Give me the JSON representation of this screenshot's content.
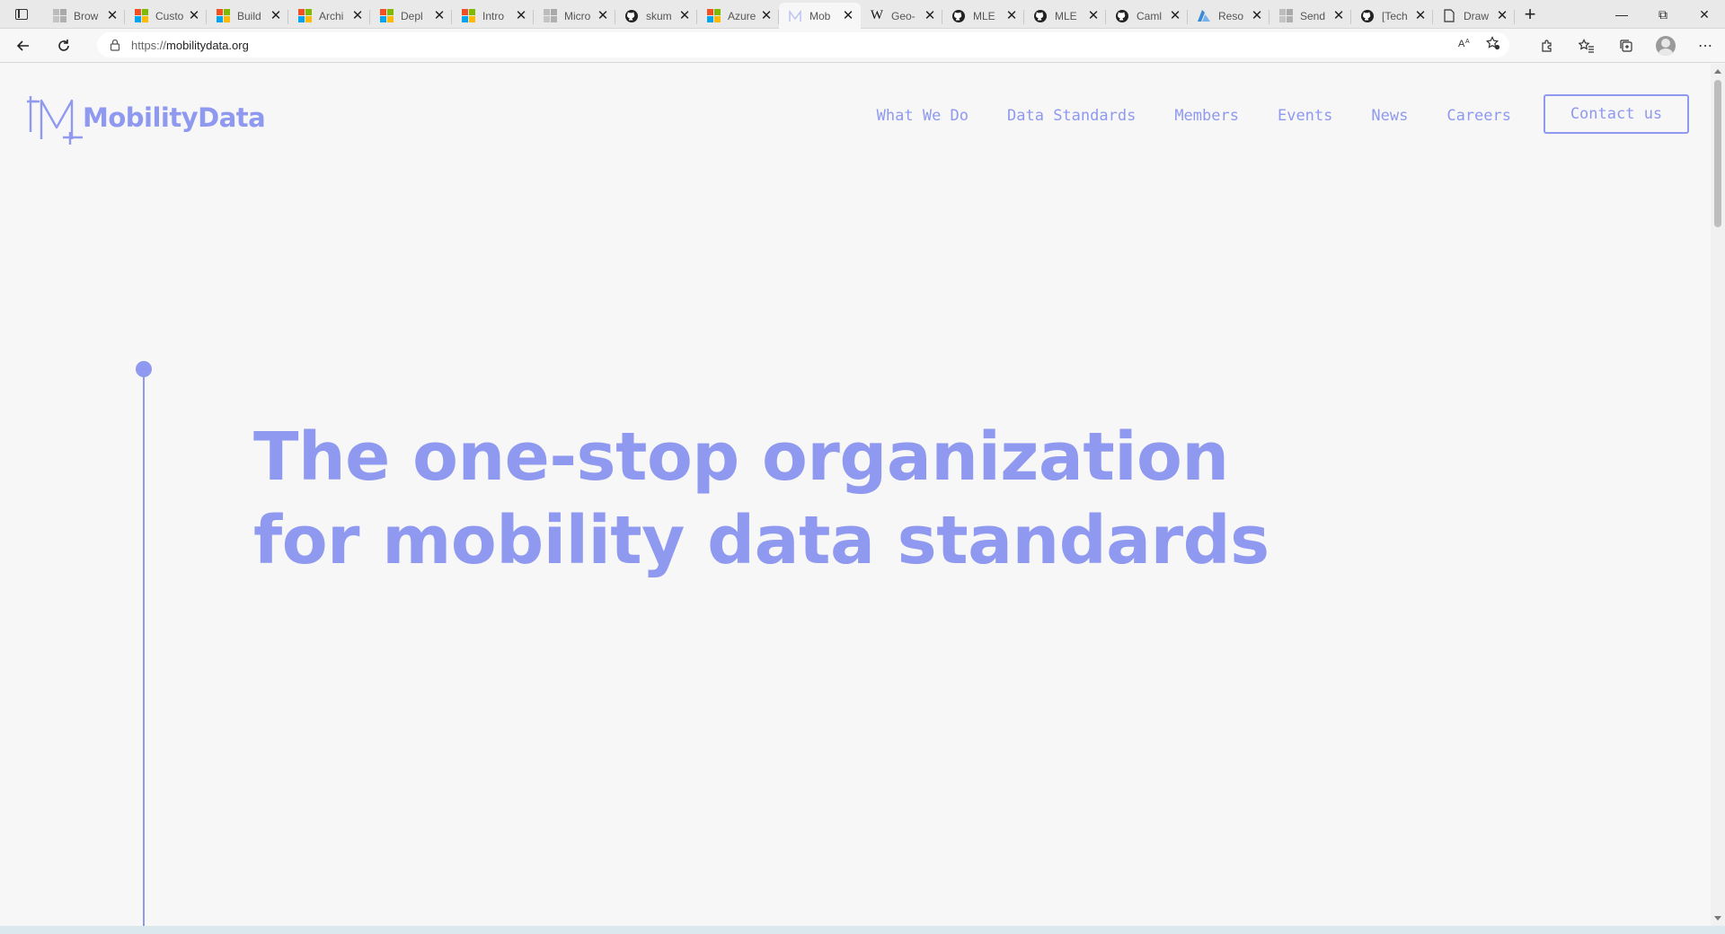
{
  "browser": {
    "tabs": [
      {
        "title": "Brow",
        "icon": "ms-gray-icon"
      },
      {
        "title": "Custo",
        "icon": "microsoft-icon"
      },
      {
        "title": "Build",
        "icon": "microsoft-icon"
      },
      {
        "title": "Archi",
        "icon": "microsoft-icon"
      },
      {
        "title": "Depl",
        "icon": "microsoft-icon"
      },
      {
        "title": "Intro",
        "icon": "microsoft-icon"
      },
      {
        "title": "Micro",
        "icon": "ms-gray-icon"
      },
      {
        "title": "skum",
        "icon": "github-icon"
      },
      {
        "title": "Azure",
        "icon": "microsoft-icon"
      },
      {
        "title": "Mob",
        "icon": "mobilitydata-icon",
        "active": true
      },
      {
        "title": "Geo-",
        "icon": "wikipedia-icon"
      },
      {
        "title": "MLE",
        "icon": "github-icon"
      },
      {
        "title": "MLE",
        "icon": "github-icon"
      },
      {
        "title": "Caml",
        "icon": "github-icon"
      },
      {
        "title": "Reso",
        "icon": "azure-icon"
      },
      {
        "title": "Send",
        "icon": "ms-gray-icon"
      },
      {
        "title": "[Tech",
        "icon": "github-icon"
      },
      {
        "title": "Draw",
        "icon": "document-icon"
      }
    ],
    "url_scheme": "https://",
    "url_host": "mobilitydata.org"
  },
  "site": {
    "logo_text": "MobilityData",
    "nav": {
      "what_we_do": "What We Do",
      "data_standards": "Data Standards",
      "members": "Members",
      "events": "Events",
      "news": "News",
      "careers": "Careers",
      "contact": "Contact us"
    },
    "hero_line1": "The one-stop organization",
    "hero_line2": "for mobility data standards"
  },
  "colors": {
    "brand": "#8f99ef",
    "page_background": "#f7f7f7"
  }
}
